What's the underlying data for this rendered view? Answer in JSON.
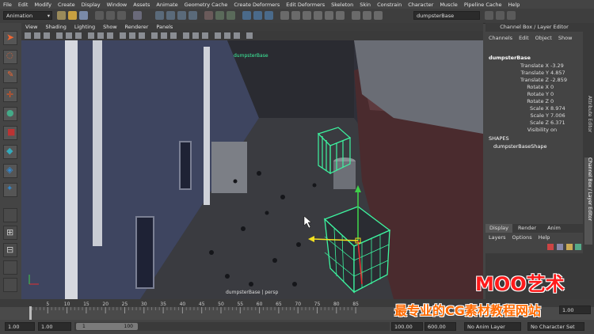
{
  "menubar": [
    "File",
    "Edit",
    "Modify",
    "Create",
    "Display",
    "Window",
    "Assets",
    "Animate",
    "Geometry Cache",
    "Create Deformers",
    "Edit Deformers",
    "Skeleton",
    "Skin",
    "Constrain",
    "Character",
    "Muscle",
    "Pipeline Cache",
    "Help"
  ],
  "statusline": {
    "menuset": "Animation",
    "name_field": "dumpsterBase"
  },
  "viewport": {
    "menu": [
      "View",
      "Shading",
      "Lighting",
      "Show",
      "Renderer",
      "Panels"
    ],
    "label_top": "dumpsterBase",
    "label_bottom": "dumpsterBase | persp"
  },
  "channelbox": {
    "title": "Channel Box / Layer Editor",
    "menu": [
      "Channels",
      "Edit",
      "Object",
      "Show"
    ],
    "object": "dumpsterBase",
    "attrs": [
      {
        "name": "Translate X",
        "value": "-3.29"
      },
      {
        "name": "Translate Y",
        "value": "4.857"
      },
      {
        "name": "Translate Z",
        "value": "-2.859"
      },
      {
        "name": "Rotate X",
        "value": "0"
      },
      {
        "name": "Rotate Y",
        "value": "0"
      },
      {
        "name": "Rotate Z",
        "value": "0"
      },
      {
        "name": "Scale X",
        "value": "8.974"
      },
      {
        "name": "Scale Y",
        "value": "7.006"
      },
      {
        "name": "Scale Z",
        "value": "6.371"
      },
      {
        "name": "Visibility",
        "value": "on"
      }
    ],
    "shapes_label": "SHAPES",
    "shape_name": "dumpsterBaseShape",
    "layer_tabs": [
      "Display",
      "Render",
      "Anim"
    ],
    "layer_menu": [
      "Layers",
      "Options",
      "Help"
    ],
    "side_tabs": [
      "Attribute Editor",
      "Channel Box / Layer Editor"
    ]
  },
  "timeline": {
    "ticks": [
      "5",
      "10",
      "15",
      "20",
      "25",
      "30",
      "35",
      "40",
      "45",
      "50",
      "55",
      "60",
      "65",
      "70",
      "75",
      "80",
      "85"
    ],
    "current": "1.00"
  },
  "rangebar": {
    "start": "1.00",
    "playback_start": "1.00",
    "slider_start": "1",
    "slider_end": "100",
    "playback_end": "100.00",
    "end": "600.00",
    "anim_layer": "No Anim Layer",
    "character_set": "No Character Set"
  },
  "watermark": {
    "line1": "MOO艺术",
    "line2": "最专业的CG素材教程网站"
  },
  "colors": {
    "accent_green": "#3df5a0",
    "manip_red": "#e23030",
    "manip_green": "#3fd04a",
    "manip_yellow": "#f3e020"
  }
}
